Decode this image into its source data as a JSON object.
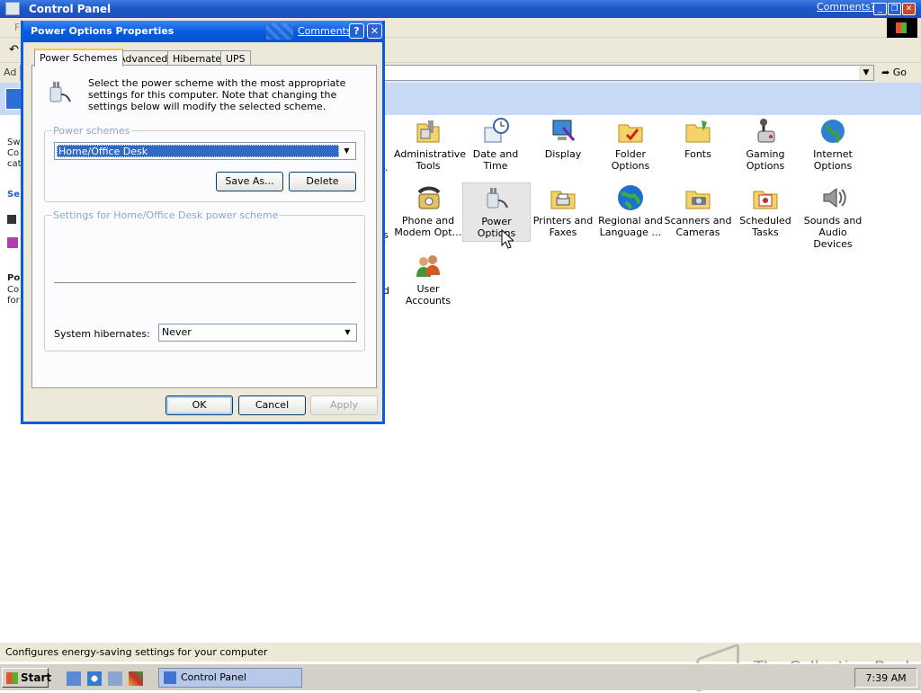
{
  "window": {
    "title": "Control Panel",
    "comments_link": "Comments?",
    "menu_initial": "F"
  },
  "address": {
    "label": "Ad",
    "go": "Go"
  },
  "left_pane_fragments": [
    "Sw",
    "Co",
    "cat",
    "Se",
    "Po",
    "Co",
    "for"
  ],
  "icons": [
    {
      "label": "Administrative Tools",
      "icon": "admin-tools-icon"
    },
    {
      "label": "Date and Time",
      "icon": "clock-icon"
    },
    {
      "label": "Display",
      "icon": "display-icon"
    },
    {
      "label": "Folder Options",
      "icon": "folder-icon"
    },
    {
      "label": "Fonts",
      "icon": "fonts-folder-icon"
    },
    {
      "label": "Gaming Options",
      "icon": "joystick-icon"
    },
    {
      "label": "Internet Options",
      "icon": "globe-icon"
    },
    {
      "label": "Phone and Modem Opt…",
      "icon": "phone-icon"
    },
    {
      "label": "Power Options",
      "icon": "power-plug-icon",
      "selected": true
    },
    {
      "label": "Printers and Faxes",
      "icon": "printer-icon"
    },
    {
      "label": "Regional and Language …",
      "icon": "world-icon"
    },
    {
      "label": "Scanners and Cameras",
      "icon": "camera-icon"
    },
    {
      "label": "Scheduled Tasks",
      "icon": "calendar-icon"
    },
    {
      "label": "Sounds and Audio Devices",
      "icon": "speaker-icon"
    },
    {
      "label": "User Accounts",
      "icon": "users-icon"
    }
  ],
  "cut_letters": [
    ".",
    "s",
    "d"
  ],
  "status_text": "Configures energy-saving settings for your computer",
  "taskbar": {
    "start": "Start",
    "task_label": "Control Panel",
    "clock": "7:39 AM"
  },
  "watermark": "The Collection Book",
  "dialog": {
    "title": "Power Options Properties",
    "comments_link": "Comments?",
    "help": "?",
    "close": "✕",
    "tabs": [
      "Power Schemes",
      "Advanced",
      "Hibernate",
      "UPS"
    ],
    "active_tab": "Power Schemes",
    "intro": "Select the power scheme with the most appropriate settings for this computer. Note that changing the settings below will modify the selected scheme.",
    "schemes_group": "Power schemes",
    "scheme_value": "Home/Office Desk",
    "save_as": "Save As...",
    "delete": "Delete",
    "settings_group": "Settings for Home/Office Desk power scheme",
    "hibernate_label": "System hibernates:",
    "hibernate_value": "Never",
    "ok": "OK",
    "cancel": "Cancel",
    "apply": "Apply"
  },
  "colors": {
    "xp_blue": "#0a5be0",
    "selection": "#316ac5",
    "banner": "#c8d9f5"
  }
}
